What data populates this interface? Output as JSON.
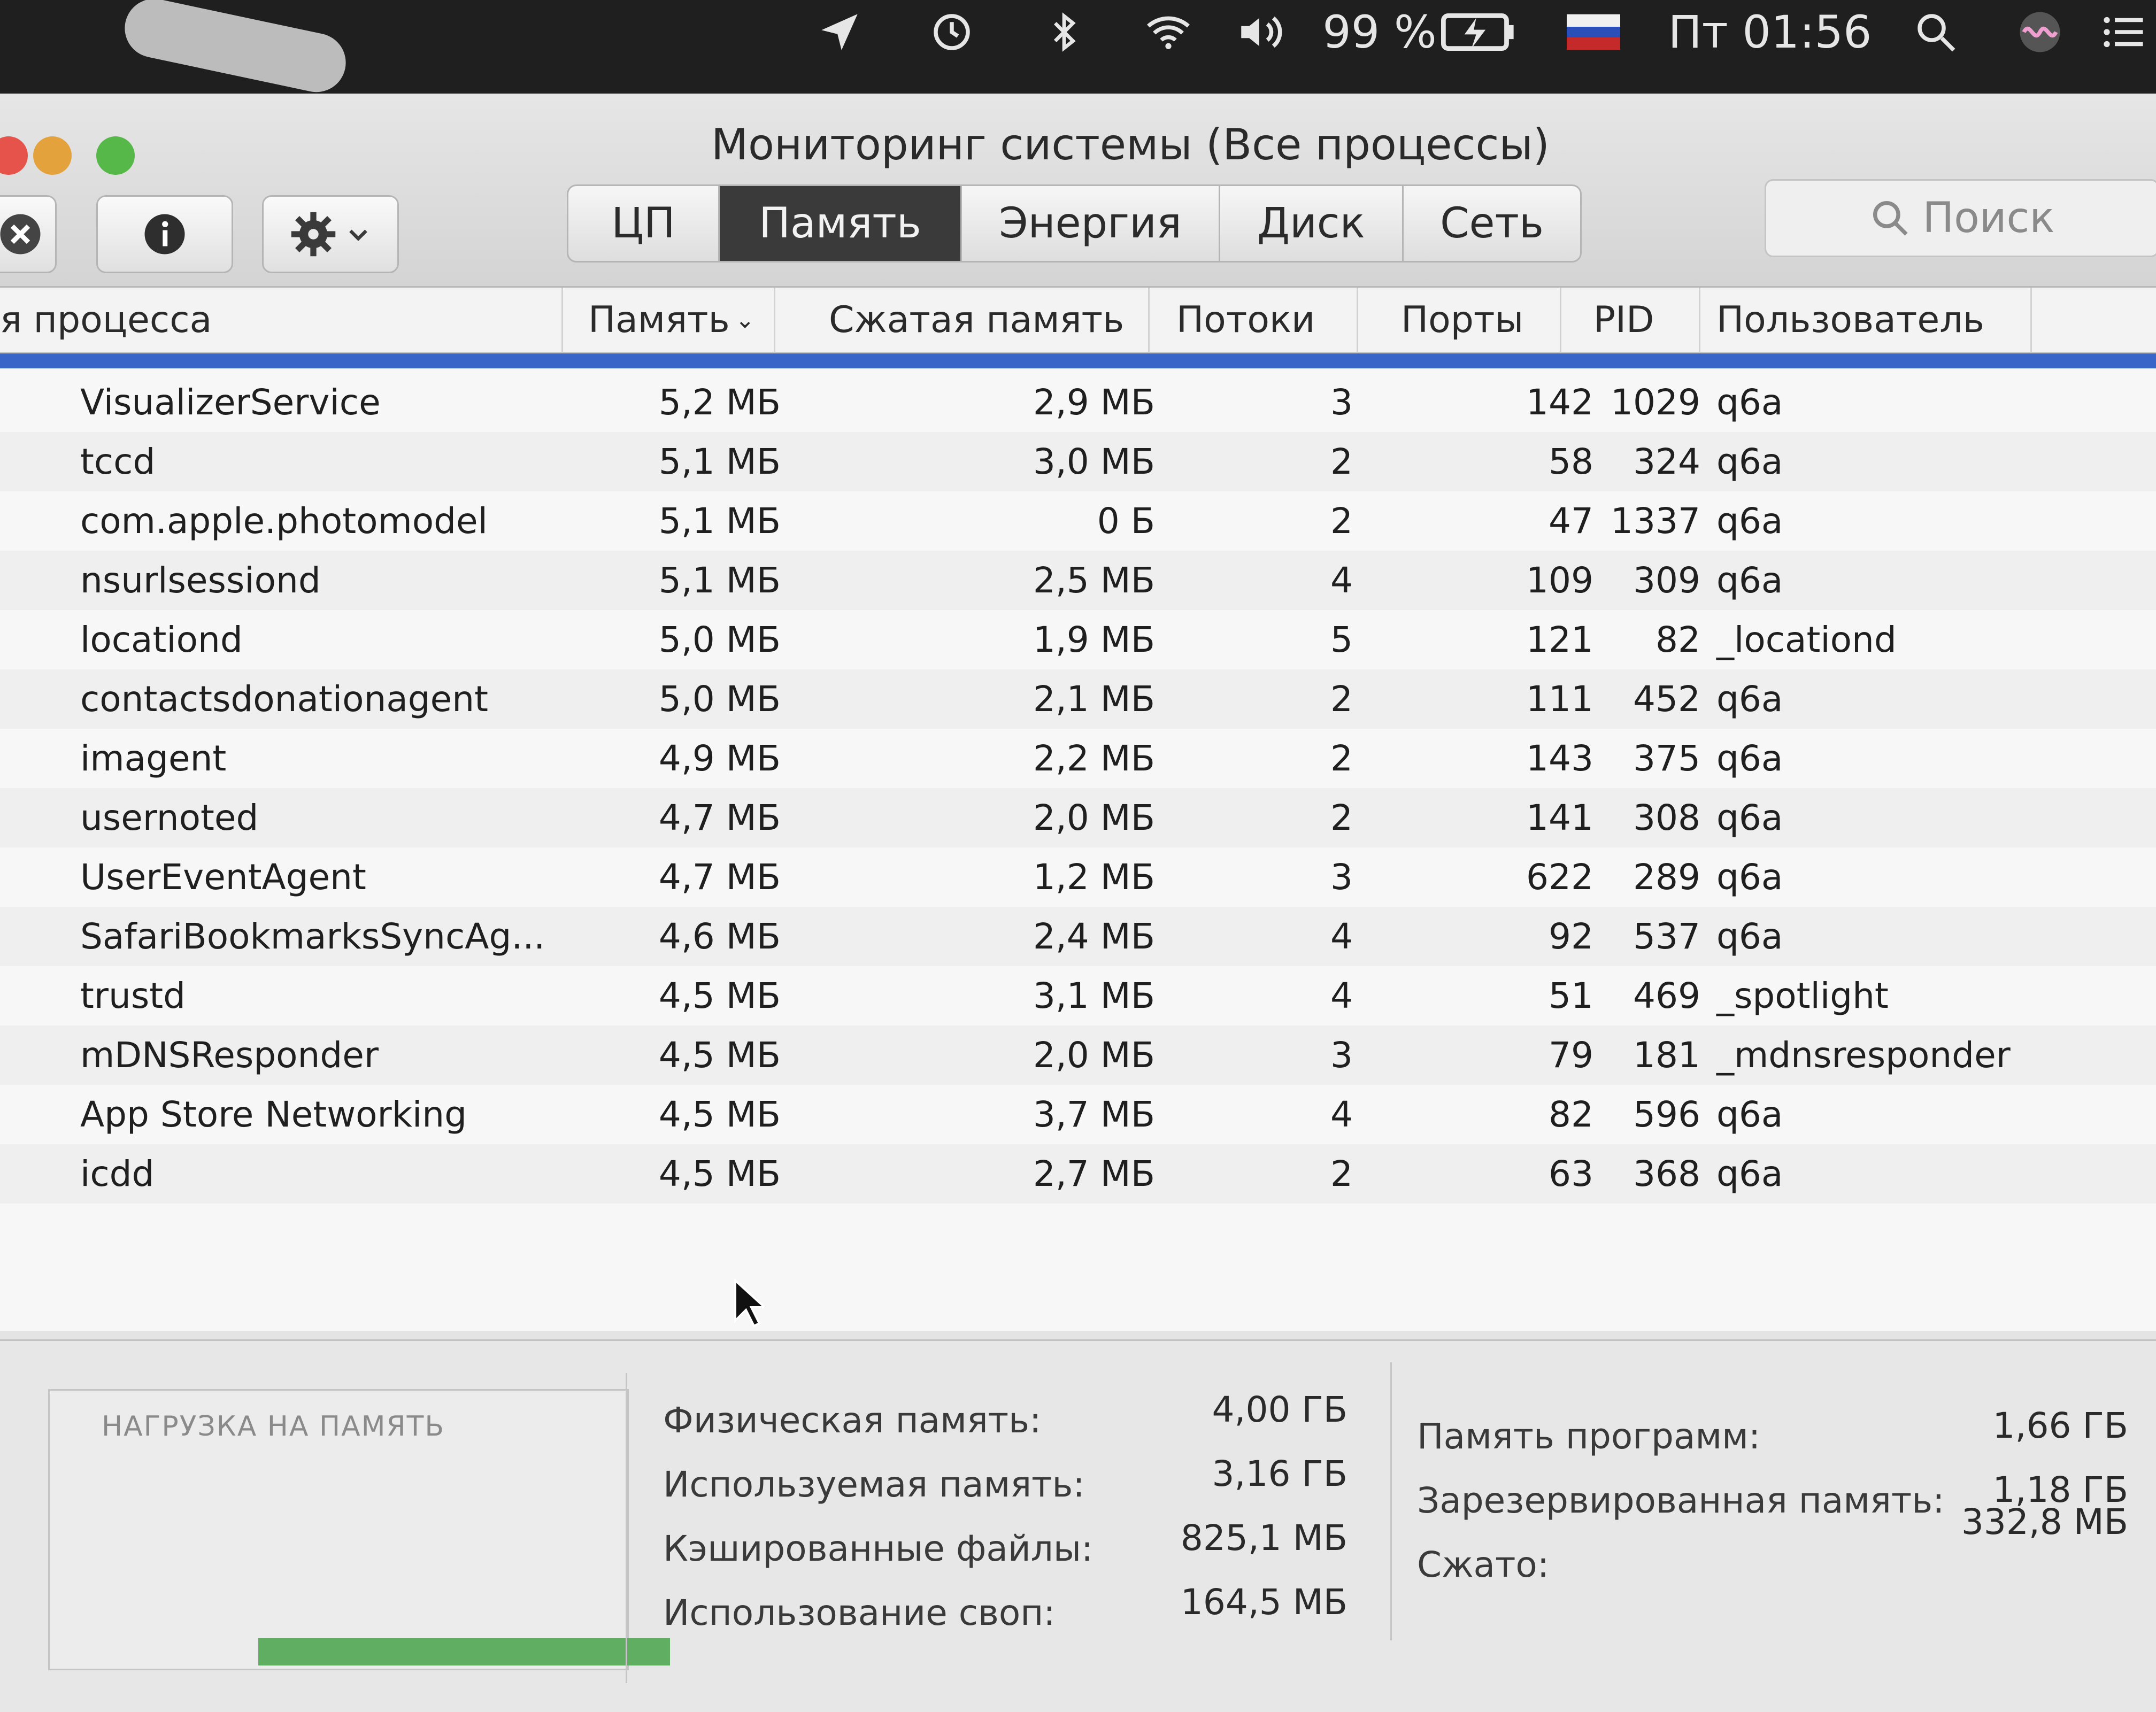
{
  "menubar": {
    "battery": "99 %",
    "clock": "Пт 01:56",
    "icons": [
      "location-arrow-icon",
      "time-machine-icon",
      "bluetooth-icon",
      "wifi-icon",
      "volume-icon",
      "battery-icon",
      "flag-ru-icon",
      "spotlight-icon",
      "siri-icon",
      "notification-center-icon"
    ]
  },
  "window": {
    "title": "Мониторинг системы (Все процессы)"
  },
  "toolbar": {
    "segments": [
      "ЦП",
      "Память",
      "Энергия",
      "Диск",
      "Сеть"
    ],
    "active_segment": "Память",
    "search_placeholder": "Поиск"
  },
  "table": {
    "headers": {
      "name": "я процесса",
      "memory": "Память",
      "compressed": "Сжатая память",
      "threads": "Потоки",
      "ports": "Порты",
      "pid": "PID",
      "user": "Пользователь"
    },
    "rows": [
      {
        "name": "VisualizerService",
        "memory": "5,2 МБ",
        "compressed": "2,9 МБ",
        "threads": "3",
        "ports": "142",
        "pid": "1029",
        "user": "q6a"
      },
      {
        "name": "tccd",
        "memory": "5,1 МБ",
        "compressed": "3,0 МБ",
        "threads": "2",
        "ports": "58",
        "pid": "324",
        "user": "q6a"
      },
      {
        "name": "com.apple.photomodel",
        "memory": "5,1 МБ",
        "compressed": "0 Б",
        "threads": "2",
        "ports": "47",
        "pid": "1337",
        "user": "q6a"
      },
      {
        "name": "nsurlsessiond",
        "memory": "5,1 МБ",
        "compressed": "2,5 МБ",
        "threads": "4",
        "ports": "109",
        "pid": "309",
        "user": "q6a"
      },
      {
        "name": "locationd",
        "memory": "5,0 МБ",
        "compressed": "1,9 МБ",
        "threads": "5",
        "ports": "121",
        "pid": "82",
        "user": "_locationd"
      },
      {
        "name": "contactsdonationagent",
        "memory": "5,0 МБ",
        "compressed": "2,1 МБ",
        "threads": "2",
        "ports": "111",
        "pid": "452",
        "user": "q6a"
      },
      {
        "name": "imagent",
        "memory": "4,9 МБ",
        "compressed": "2,2 МБ",
        "threads": "2",
        "ports": "143",
        "pid": "375",
        "user": "q6a"
      },
      {
        "name": "usernoted",
        "memory": "4,7 МБ",
        "compressed": "2,0 МБ",
        "threads": "2",
        "ports": "141",
        "pid": "308",
        "user": "q6a"
      },
      {
        "name": "UserEventAgent",
        "memory": "4,7 МБ",
        "compressed": "1,2 МБ",
        "threads": "3",
        "ports": "622",
        "pid": "289",
        "user": "q6a"
      },
      {
        "name": "SafariBookmarksSyncAg...",
        "memory": "4,6 МБ",
        "compressed": "2,4 МБ",
        "threads": "4",
        "ports": "92",
        "pid": "537",
        "user": "q6a"
      },
      {
        "name": "trustd",
        "memory": "4,5 МБ",
        "compressed": "3,1 МБ",
        "threads": "4",
        "ports": "51",
        "pid": "469",
        "user": "_spotlight"
      },
      {
        "name": "mDNSResponder",
        "memory": "4,5 МБ",
        "compressed": "2,0 МБ",
        "threads": "3",
        "ports": "79",
        "pid": "181",
        "user": "_mdnsresponder"
      },
      {
        "name": "App Store Networking",
        "memory": "4,5 МБ",
        "compressed": "3,7 МБ",
        "threads": "4",
        "ports": "82",
        "pid": "596",
        "user": "q6a"
      },
      {
        "name": "icdd",
        "memory": "4,5 МБ",
        "compressed": "2,7 МБ",
        "threads": "2",
        "ports": "63",
        "pid": "368",
        "user": "q6a"
      }
    ]
  },
  "memory_pressure": {
    "label": "НАГРУЗКА НА ПАМЯТЬ",
    "level_fraction": 0.1,
    "color": "#5fae62"
  },
  "stats_left": [
    {
      "label": "Физическая память:",
      "value": "4,00 ГБ"
    },
    {
      "label": "Используемая память:",
      "value": "3,16 ГБ"
    },
    {
      "label": "Кэшированные файлы:",
      "value": "825,1 МБ"
    },
    {
      "label": "Использование своп:",
      "value": "164,5 МБ"
    }
  ],
  "stats_right": [
    {
      "label": "Память программ:",
      "value": "1,66 ГБ"
    },
    {
      "label": "Зарезервированная память:",
      "value": "1,18 ГБ"
    },
    {
      "label": "Сжато:",
      "value": "332,8 МБ"
    }
  ]
}
